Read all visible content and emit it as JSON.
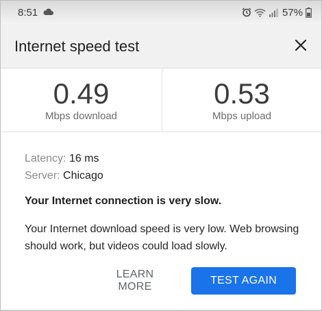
{
  "status_bar": {
    "time": "8:51",
    "battery": "57%",
    "icons": [
      "cloud-icon",
      "alarm-icon",
      "wifi-icon",
      "signal-icon",
      "battery-icon"
    ]
  },
  "header": {
    "title": "Internet speed test",
    "close_icon": "close-icon"
  },
  "results": {
    "download": {
      "value": "0.49",
      "label": "Mbps download"
    },
    "upload": {
      "value": "0.53",
      "label": "Mbps upload"
    }
  },
  "details": {
    "latency_label": "Latency:",
    "latency_value": "16 ms",
    "server_label": "Server:",
    "server_value": "Chicago"
  },
  "summary": {
    "title": "Your Internet connection is very slow.",
    "body": "Your Internet download speed is very low. Web browsing should work, but videos could load slowly."
  },
  "actions": {
    "learn_more": "LEARN MORE",
    "test_again": "TEST AGAIN"
  },
  "colors": {
    "accent": "#1a73e8",
    "header_bg": "#f1f1f1"
  }
}
